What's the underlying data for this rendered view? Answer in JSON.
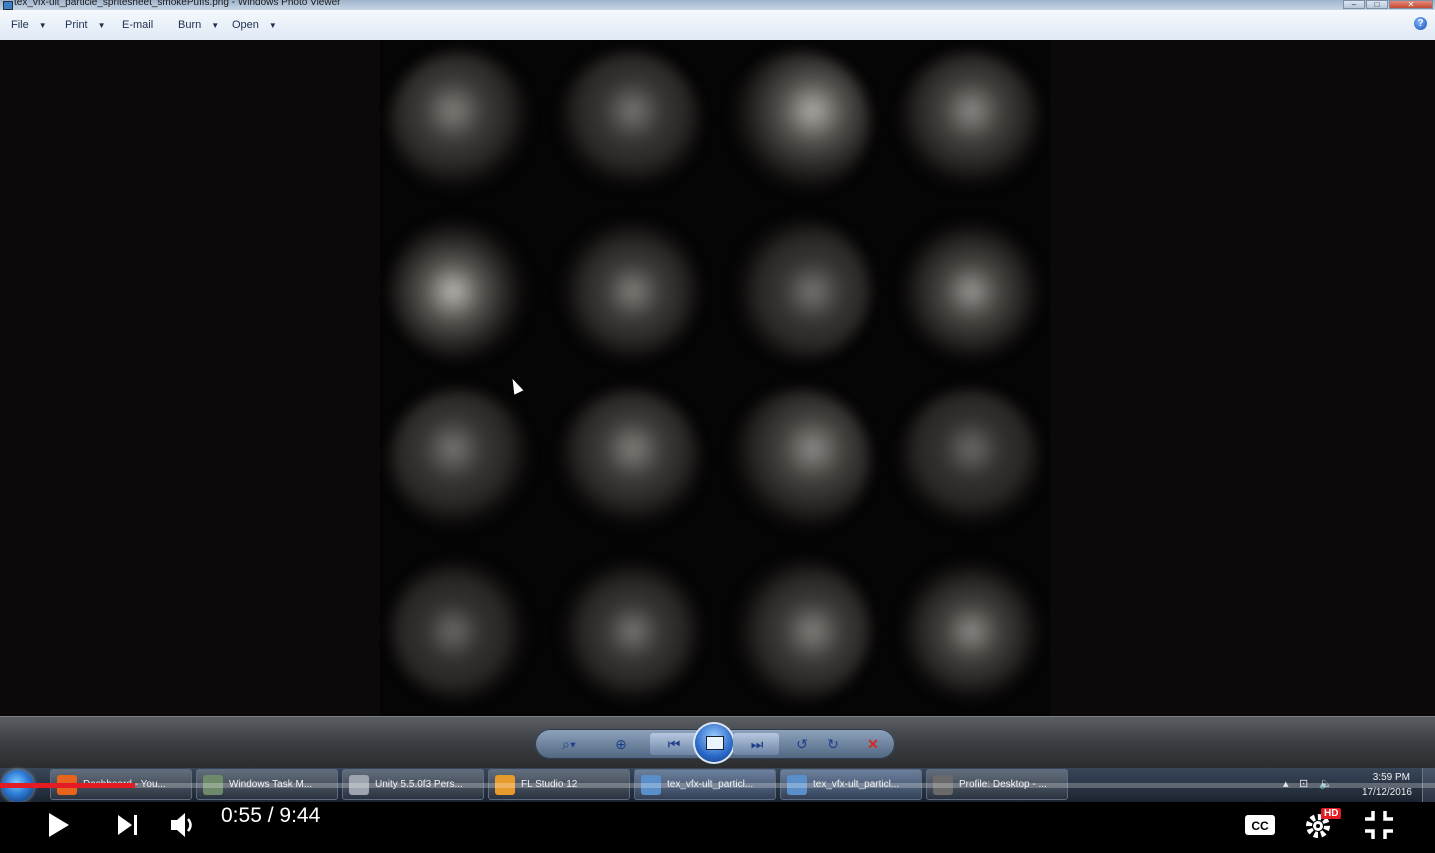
{
  "window": {
    "title": "tex_vfx-ult_particle_spritesheet_smokePuffs.png - Windows Photo Viewer",
    "min_icon": "minimize-icon",
    "max_icon": "maximize-icon",
    "close_icon": "close-icon"
  },
  "menu": [
    {
      "label": "File",
      "dropdown": true
    },
    {
      "label": "Print",
      "dropdown": true
    },
    {
      "label": "E-mail",
      "dropdown": false
    },
    {
      "label": "Burn",
      "dropdown": true
    },
    {
      "label": "Open",
      "dropdown": true
    }
  ],
  "help_icon": "help-icon",
  "viewer_controls": [
    "zoom-icon",
    "actual-size-icon",
    "previous-icon",
    "slideshow-icon",
    "next-icon",
    "rotate-counterclockwise-icon",
    "rotate-clockwise-icon",
    "delete-icon"
  ],
  "taskbar": {
    "tasks": [
      {
        "label": "Dashboard - You...",
        "icon": "firefox-icon",
        "color": "#e8631c"
      },
      {
        "label": "Windows Task M...",
        "icon": "task-manager-icon",
        "color": "#6e8a6a"
      },
      {
        "label": "Unity 5.5.0f3 Pers...",
        "icon": "unity-icon",
        "color": "#9ea4ad"
      },
      {
        "label": "FL Studio 12",
        "icon": "fl-studio-icon",
        "color": "#e89b2d"
      },
      {
        "label": "tex_vfx-ult_particl...",
        "icon": "photo-viewer-icon",
        "color": "#5b8fc9"
      },
      {
        "label": "tex_vfx-ult_particl...",
        "icon": "photo-viewer-icon",
        "color": "#5b8fc9"
      },
      {
        "label": "Profile: Desktop - ...",
        "icon": "obs-icon",
        "color": "#6a6a6a"
      }
    ],
    "clock_time": "3:59 PM",
    "clock_date": "17/12/2016"
  },
  "player": {
    "current_time": "0:55",
    "separator": " / ",
    "duration": "9:44",
    "progress": 0.094,
    "accent_color": "#e21c22",
    "hd_badge": "HD"
  }
}
